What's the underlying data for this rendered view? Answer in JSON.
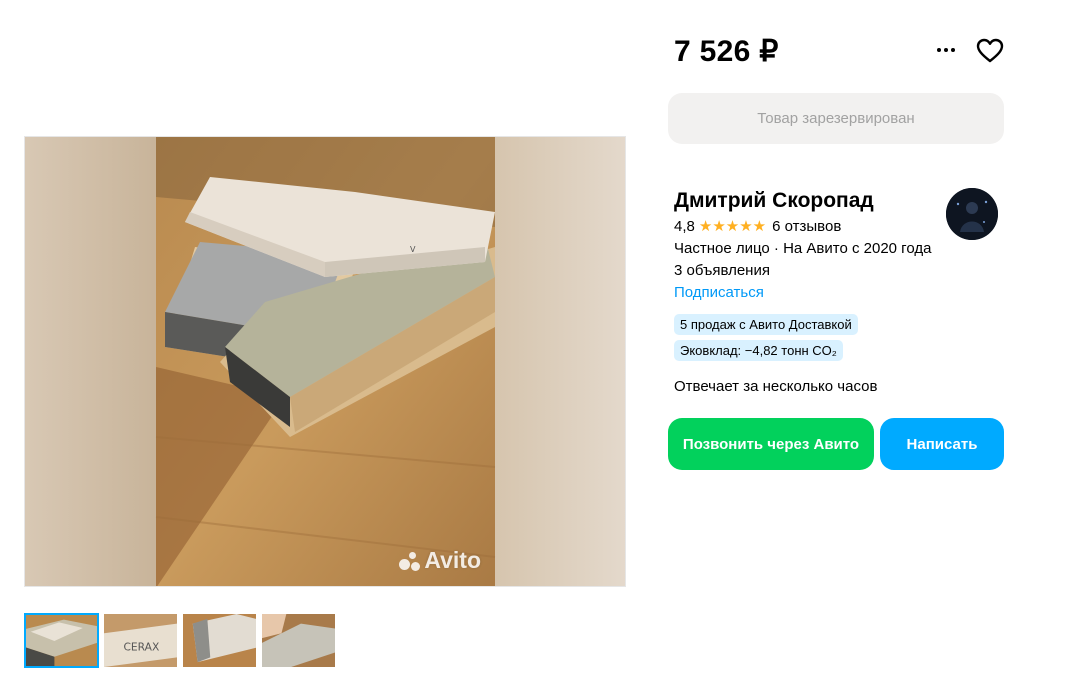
{
  "listing": {
    "price": "7 526 ₽",
    "reserved_label": "Товар зарезервирован"
  },
  "gallery": {
    "watermark": "Avito",
    "thumbnails": [
      {
        "label": "",
        "active": true
      },
      {
        "label": "CERAX",
        "active": false
      },
      {
        "label": "",
        "active": false
      },
      {
        "label": "",
        "active": false
      }
    ]
  },
  "seller": {
    "name": "Дмитрий Скоропад",
    "rating": "4,8",
    "stars": 5,
    "reviews": "6 отзывов",
    "type_since": "Частное лицо · На Авито с 2020 года",
    "ads_count": "3 объявления",
    "subscribe_label": "Подписаться",
    "badges": [
      "5 продаж с Авито Доставкой",
      "Эковклад: −4,82 тонн CO₂"
    ],
    "response_time": "Отвечает за несколько часов"
  },
  "actions": {
    "call_label": "Позвонить через Авито",
    "write_label": "Написать"
  },
  "icons": {
    "more": "more-dots-icon",
    "favorite": "heart-icon",
    "star": "star-icon"
  },
  "colors": {
    "call_button": "#02d15c",
    "write_button": "#00aaff",
    "link": "#0099f7",
    "star": "#ffb021",
    "badge_bg": "#d9f1ff",
    "reserved_bg": "#f2f1f0"
  }
}
